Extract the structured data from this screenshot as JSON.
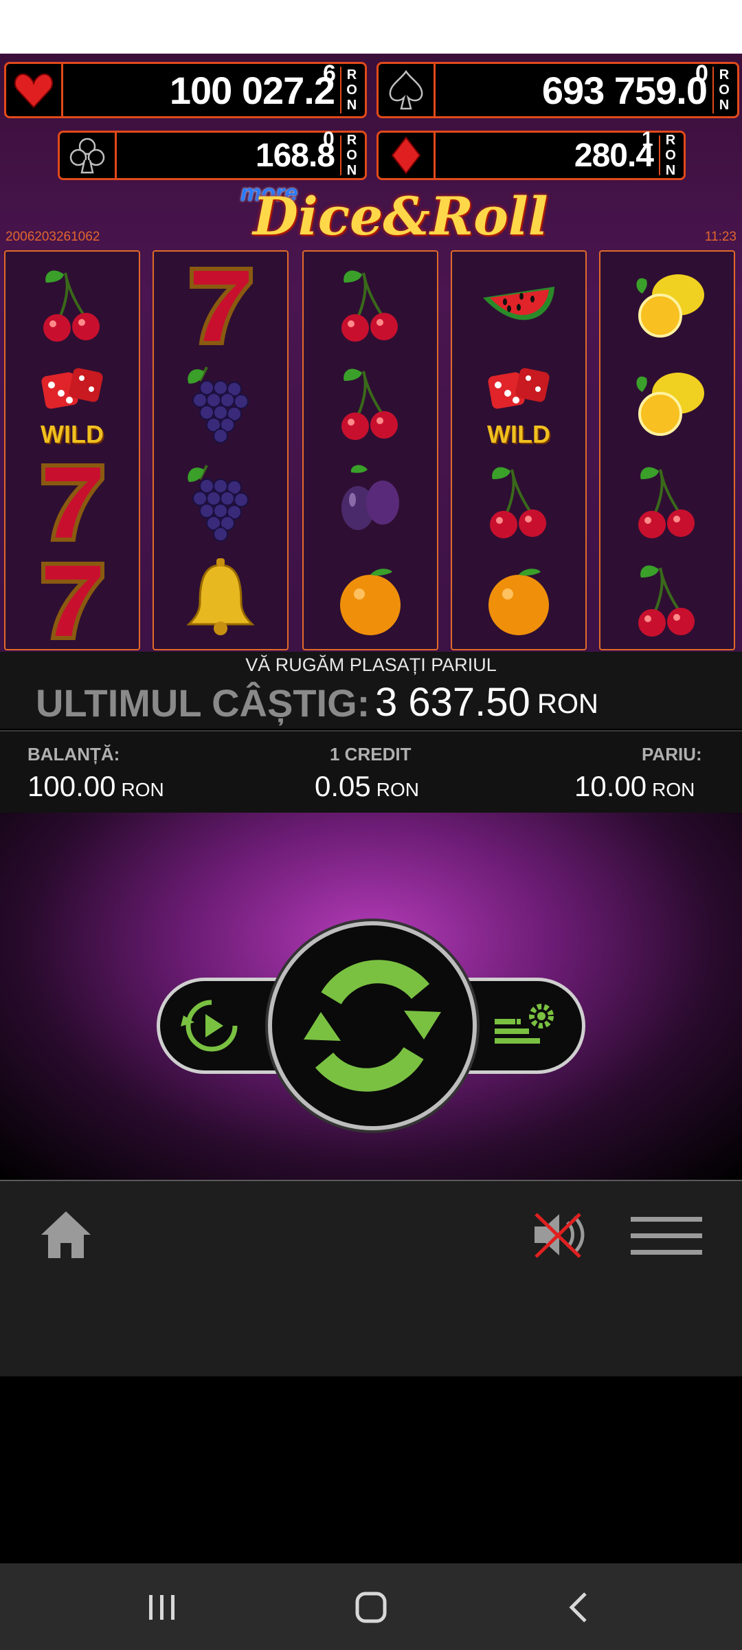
{
  "jackpots": [
    {
      "suit": "heart-icon",
      "value": "100 027.2",
      "digit": "6",
      "currency": [
        "R",
        "O",
        "N"
      ],
      "color": "#e02020"
    },
    {
      "suit": "spade-icon",
      "value": "693 759.0",
      "digit": "0",
      "currency": [
        "R",
        "O",
        "N"
      ],
      "color": "#bfbfbf"
    },
    {
      "suit": "club-icon",
      "value": "168.8",
      "digit": "0",
      "currency": [
        "R",
        "O",
        "N"
      ],
      "color": "#bfbfbf"
    },
    {
      "suit": "diamond-icon",
      "value": "280.4",
      "digit": "1",
      "currency": [
        "R",
        "O",
        "N"
      ],
      "color": "#e02020"
    }
  ],
  "game": {
    "logo_small": "more",
    "logo_main": "Dice&Roll",
    "machine_id": "2006203261062",
    "clock": "11:23"
  },
  "reels": [
    [
      "cherries",
      "dice-wild",
      "seven",
      "seven"
    ],
    [
      "seven",
      "grapes",
      "grapes",
      "bell"
    ],
    [
      "cherries",
      "cherries",
      "plums",
      "orange"
    ],
    [
      "watermelon",
      "dice-wild",
      "cherries",
      "orange"
    ],
    [
      "lemon",
      "lemon",
      "cherries",
      "cherries"
    ]
  ],
  "wild_label": "WILD",
  "message": "VĂ RUGĂM PLASAȚI PARIUL",
  "last_win": {
    "label": "ULTIMUL CÂȘTIG:",
    "value": "3 637.50",
    "currency": "RON"
  },
  "info": {
    "balance": {
      "label": "BALANȚĂ:",
      "value": "100.00",
      "currency": "RON"
    },
    "credit": {
      "label": "1 CREDIT",
      "value": "0.05",
      "currency": "RON"
    },
    "bet": {
      "label": "PARIU:",
      "value": "10.00",
      "currency": "RON"
    }
  },
  "controls": {
    "autoplay_icon": "autoplay-icon",
    "spin_icon": "spin-icon",
    "settings_icon": "bet-settings-icon"
  },
  "toolbar": {
    "home_icon": "home-icon",
    "sound_icon": "sound-muted-icon",
    "menu_icon": "hamburger-menu-icon"
  },
  "colors": {
    "accent_orange": "#e24a1a",
    "spin_green": "#7ac142",
    "purple": "#6b1c74"
  }
}
